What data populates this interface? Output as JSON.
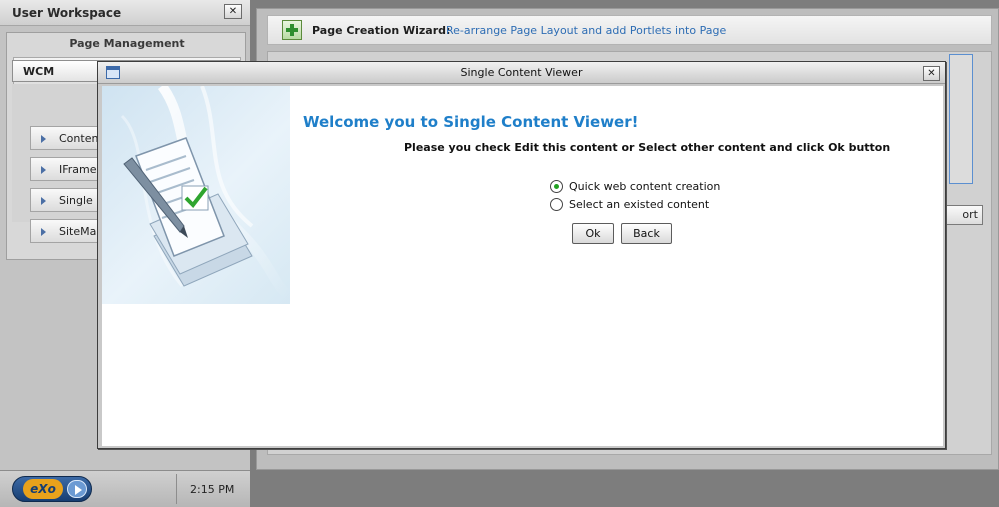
{
  "workspace": {
    "title": "User Workspace",
    "close_label": "✕",
    "page_management": {
      "title": "Page Management",
      "tab_label": "WCM",
      "items": [
        {
          "label": "Content"
        },
        {
          "label": "IFrame"
        },
        {
          "label": "Single C"
        },
        {
          "label": "SiteMap"
        }
      ]
    }
  },
  "wizard": {
    "title": "Page Creation Wizard:",
    "description": "Re-arrange Page Layout and add Portlets into Page",
    "partial_button_label": "ort"
  },
  "taskbar": {
    "logo_text": "eXo",
    "clock": "2:15 PM"
  },
  "dialog": {
    "title": "Single Content Viewer",
    "close_label": "✕",
    "heading": "Welcome you to Single Content Viewer!",
    "instructions": "Please you check Edit this content or Select other content and click Ok button",
    "options": [
      {
        "label": "Quick web content creation",
        "checked": true
      },
      {
        "label": "Select an existed content",
        "checked": false
      }
    ],
    "ok_label": "Ok",
    "back_label": "Back"
  },
  "colors": {
    "heading": "#1f7fc9",
    "link": "#2e6db4",
    "radio_selected": "#21a121",
    "desktop": "#7d7d7d"
  }
}
